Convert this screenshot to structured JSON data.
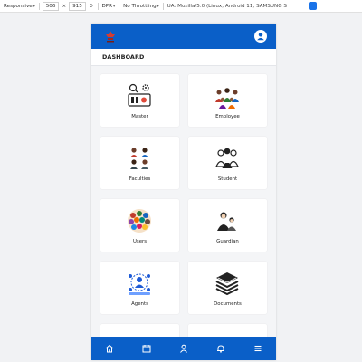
{
  "devtools": {
    "device": "Responsive",
    "width": "506",
    "times": "×",
    "height": "915",
    "dpr": "DPR",
    "throttle": "No Throttling",
    "ua": "UA: Mozilla/5.0 (Linux; Android 11; SAMSUNG S"
  },
  "app": {
    "title": "DASHBOARD",
    "accent": "#0a5fc8"
  },
  "tiles": [
    {
      "label": "Master",
      "icon": "master-control-icon"
    },
    {
      "label": "Employee",
      "icon": "employee-group-icon"
    },
    {
      "label": "Faculties",
      "icon": "faculties-icon"
    },
    {
      "label": "Student",
      "icon": "student-icon"
    },
    {
      "label": "Users",
      "icon": "users-crowd-icon"
    },
    {
      "label": "Guardian",
      "icon": "guardian-icon"
    },
    {
      "label": "Agents",
      "icon": "agents-icon"
    },
    {
      "label": "Documents",
      "icon": "documents-stack-icon"
    }
  ],
  "bottom_nav": [
    "home-icon",
    "calendar-icon",
    "profile-icon",
    "bell-icon",
    "menu-icon"
  ]
}
